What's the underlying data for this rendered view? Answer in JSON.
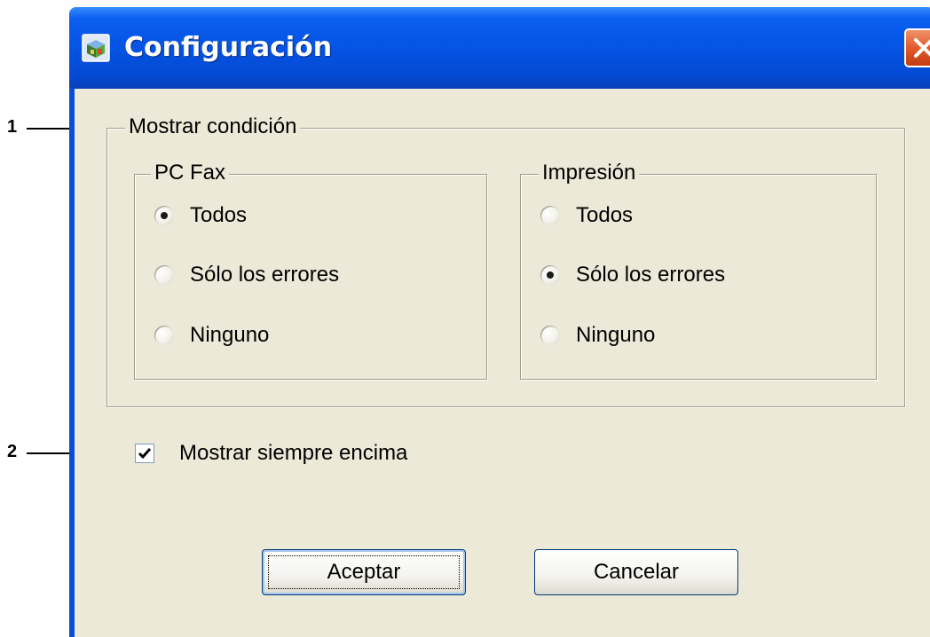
{
  "window": {
    "title": "Configuración",
    "app_icon": "printer-status-icon",
    "close_icon": "close-icon"
  },
  "callouts": [
    "1",
    "2"
  ],
  "display_condition": {
    "label": "Mostrar condición",
    "pc_fax": {
      "label": "PC Fax",
      "options": [
        "Todos",
        "Sólo los errores",
        "Ninguno"
      ],
      "selected": "Todos"
    },
    "printing": {
      "label": "Impresión",
      "options": [
        "Todos",
        "Sólo los errores",
        "Ninguno"
      ],
      "selected": "Sólo los errores"
    }
  },
  "always_on_top": {
    "label": "Mostrar siempre encima",
    "checked": true
  },
  "buttons": {
    "ok": "Aceptar",
    "cancel": "Cancelar"
  }
}
